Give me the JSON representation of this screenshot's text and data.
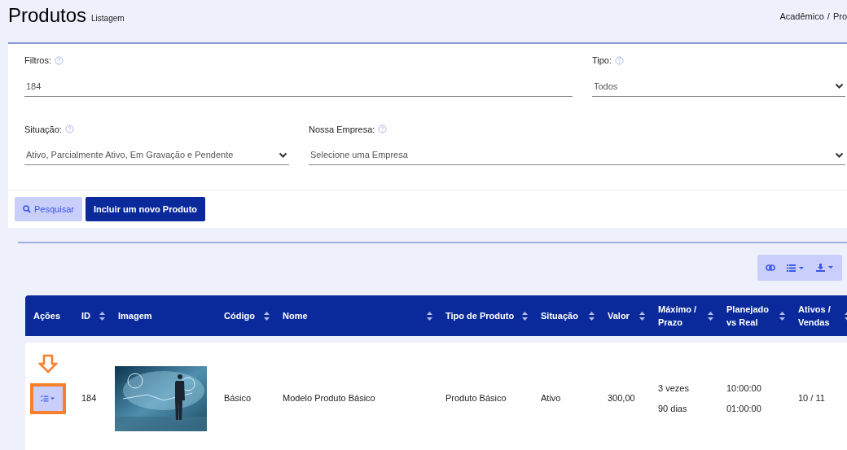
{
  "page": {
    "title": "Produtos",
    "subtitle": "Listagem"
  },
  "breadcrumb": [
    "Acadêmico",
    "/",
    "Pro"
  ],
  "filters": [
    {
      "kind": "text",
      "label": "Filtros:",
      "value": "184"
    },
    {
      "kind": "select",
      "label": "Tipo:",
      "value": "Todos"
    },
    {
      "kind": "select",
      "label": "Situação:",
      "value": "Ativo, Parcialmente Ativo, Em Gravação e Pendente"
    },
    {
      "kind": "select",
      "label": "Nossa Empresa:",
      "placeholder": "Selecione uma Empresa"
    }
  ],
  "buttons": [
    {
      "kind": "search",
      "label": "Pesquisar"
    },
    {
      "kind": "primary",
      "label": "Incluir um novo Produto"
    }
  ],
  "toolbar": [
    {
      "kind": "toggle"
    },
    {
      "kind": "columns"
    },
    {
      "kind": "export"
    }
  ],
  "table": {
    "columns": [
      {
        "label": "Ações",
        "sortable": false
      },
      {
        "label": "ID",
        "sortable": true
      },
      {
        "label": "Imagem",
        "sortable": false
      },
      {
        "label": "Código",
        "sortable": true
      },
      {
        "label": "Nome",
        "sortable": true
      },
      {
        "label": "Tipo de Produto",
        "sortable": true
      },
      {
        "label": "Situação",
        "sortable": true
      },
      {
        "label": "Valor",
        "sortable": true
      },
      {
        "label": "Máximo / Prazo",
        "sortable": true
      },
      {
        "label": "Planejado vs Real",
        "sortable": true
      },
      {
        "label": "Ativos / Vendas",
        "sortable": true
      }
    ],
    "rows": [
      {
        "highlighted": true,
        "id": "184",
        "image": {
          "kind": "picture"
        },
        "codigo": "Básico",
        "nome": "Modelo Produto Básico",
        "tipo": "Produto Básico",
        "situacao": "Ativo",
        "valor": "300,00",
        "maximo": [
          "3 vezes",
          "90 dias"
        ],
        "planejado": [
          "10:00:00",
          "01:00:00"
        ],
        "ativos": "10 / 11"
      }
    ]
  }
}
